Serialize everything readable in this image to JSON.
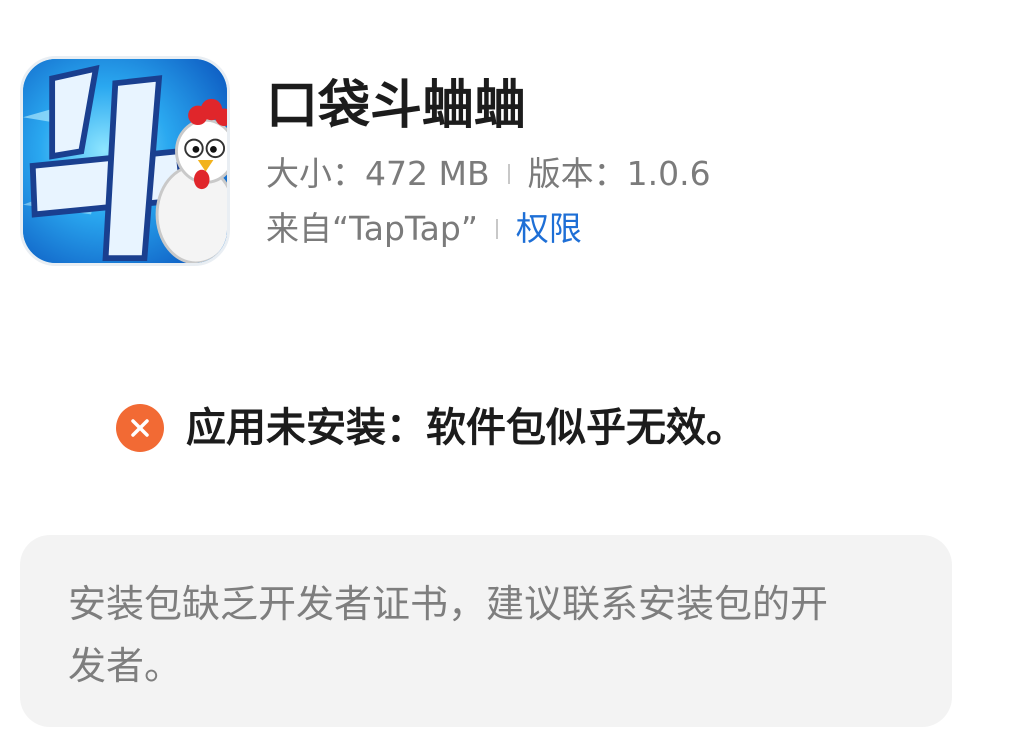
{
  "app": {
    "name": "口袋斗蛐蛐",
    "icon": "app-icon-rooster-4",
    "size_label": "大小：472 MB",
    "version_label": "版本：1.0.6",
    "source_label": "来自“TapTap”",
    "permissions_label": "权限"
  },
  "status": {
    "icon": "error-x-icon",
    "message": "应用未安装：软件包似乎无效。",
    "color": "#f26a34"
  },
  "details": {
    "message": "安装包缺乏开发者证书，建议联系安装包的开发者。"
  },
  "colors": {
    "link": "#1e6fd6",
    "error": "#f26a34",
    "panel": "#f3f3f3"
  }
}
